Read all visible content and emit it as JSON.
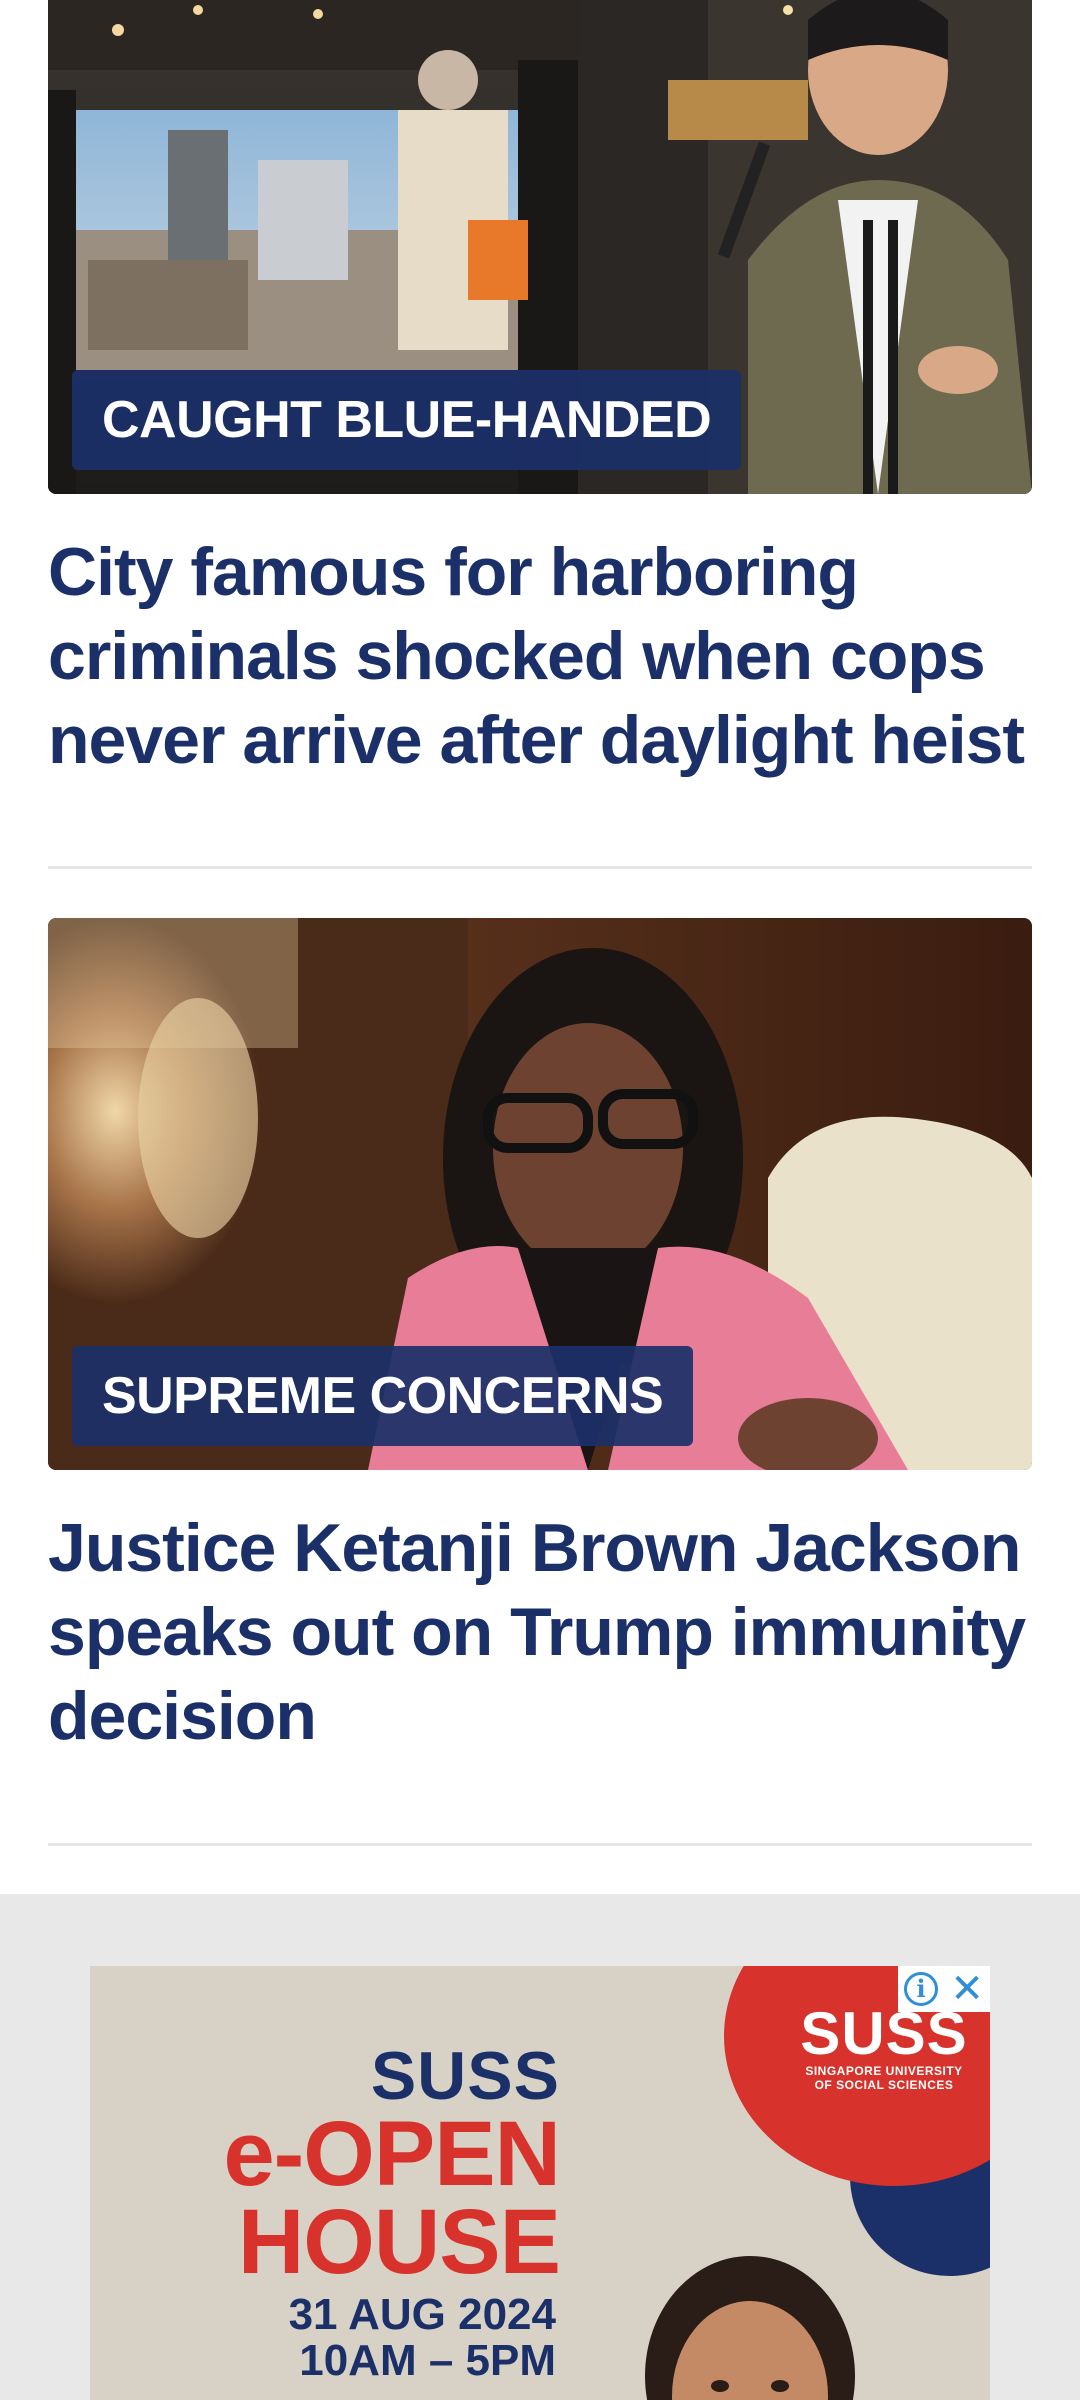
{
  "feed": {
    "articles": [
      {
        "kicker": "CAUGHT BLUE-HANDED",
        "headline": "City famous for harboring criminals shocked when cops never arrive after daylight heist"
      },
      {
        "kicker": "SUPREME CONCERNS",
        "headline": "Justice Ketanji Brown Jackson speaks out on Trump immunity decision"
      }
    ]
  },
  "ad": {
    "info_icon": "info-icon",
    "close_icon": "close-icon",
    "line1": "SUSS",
    "line2": "e-OPEN",
    "line3": "HOUSE",
    "date": "31 AUG 2024",
    "time": "10AM – 5PM",
    "logo_name": "SUSS",
    "logo_sub1": "SINGAPORE UNIVERSITY",
    "logo_sub2": "OF SOCIAL SCIENCES"
  },
  "colors": {
    "headline": "#1b3069",
    "kicker_bg": "#1b3069",
    "ad_red": "#d7322b",
    "ad_navy": "#1b3069"
  }
}
